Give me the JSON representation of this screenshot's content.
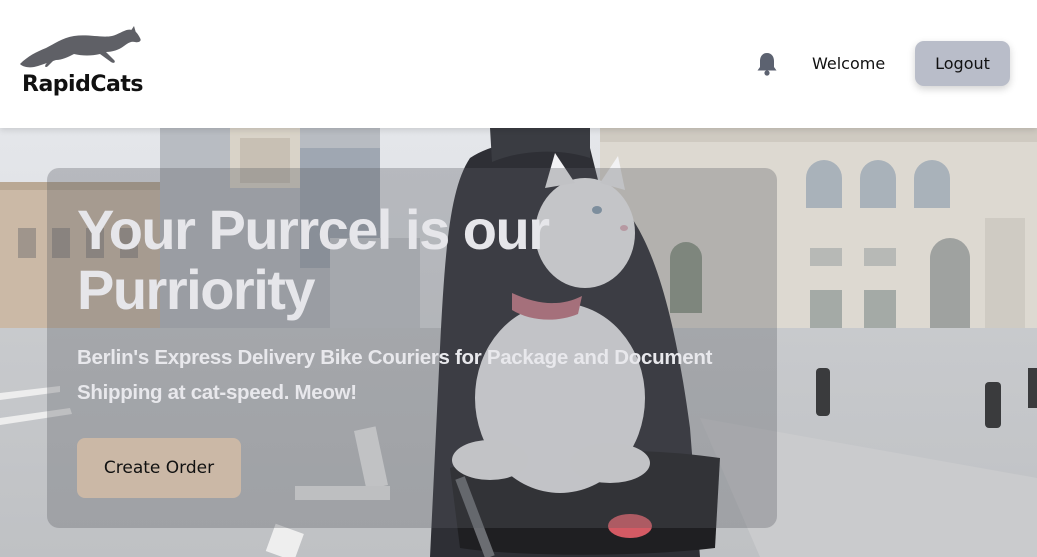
{
  "brand": {
    "name": "RapidCats",
    "logo_icon": "running-cat-icon"
  },
  "header": {
    "notification_icon": "bell-icon",
    "welcome_text": "Welcome",
    "logout_label": "Logout"
  },
  "hero": {
    "title": "Your Purrcel is our Purriority",
    "subtitle": "Berlin's Express Delivery Bike Couriers for Package and Document Shipping at cat-speed. Meow!",
    "cta_label": "Create Order",
    "background_image": "cat-in-bike-basket-street-photo"
  },
  "colors": {
    "logout_button": "#b9bdc9",
    "cta_button": "#cbb8a6",
    "header_bg": "#ffffff"
  }
}
